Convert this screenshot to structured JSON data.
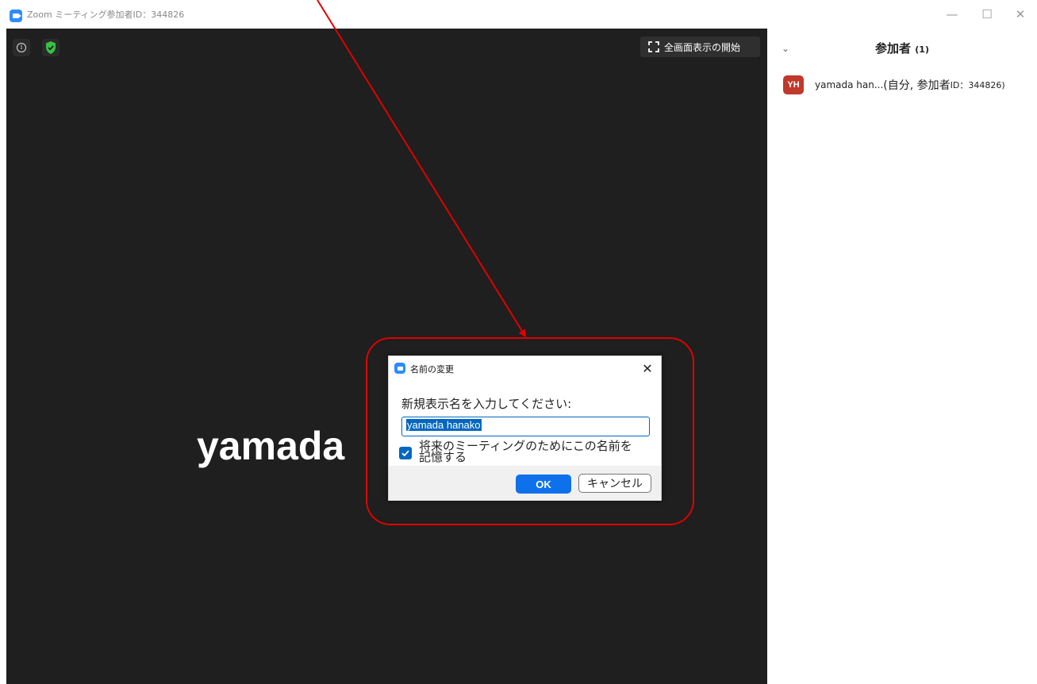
{
  "window": {
    "title": "Zoom ミーティング参加者ID：344826",
    "minimize": "—",
    "maximize": "☐",
    "close": "✕"
  },
  "video": {
    "info_icon": "i",
    "fullscreen_icon": "⛶",
    "fullscreen_label": "全画面表示の開始",
    "display_name": "yamada"
  },
  "participants": {
    "collapse_icon": "⌄",
    "title": "参加者",
    "count": "(1)",
    "items": [
      {
        "initials": "YH",
        "name": "yamada han...",
        "meta": " (自分, 参加者",
        "id_label": "ID",
        "id_value": "：344826)",
        "avatar_color": "#c0392b"
      }
    ]
  },
  "dialog": {
    "title": "名前の変更",
    "close": "✕",
    "prompt": "新規表示名を入力してください:",
    "input_value": "yamada hanako",
    "remember_checked": true,
    "remember_label": "将来のミーティングのためにこの名前を記憶する",
    "ok_label": "OK",
    "cancel_label": "キャンセル"
  },
  "colors": {
    "zoom_blue": "#2d8cff",
    "accent_blue": "#0e71eb",
    "annotation_red": "#e00000",
    "video_bg": "#1f1f1f",
    "shield_green": "#36c244"
  }
}
